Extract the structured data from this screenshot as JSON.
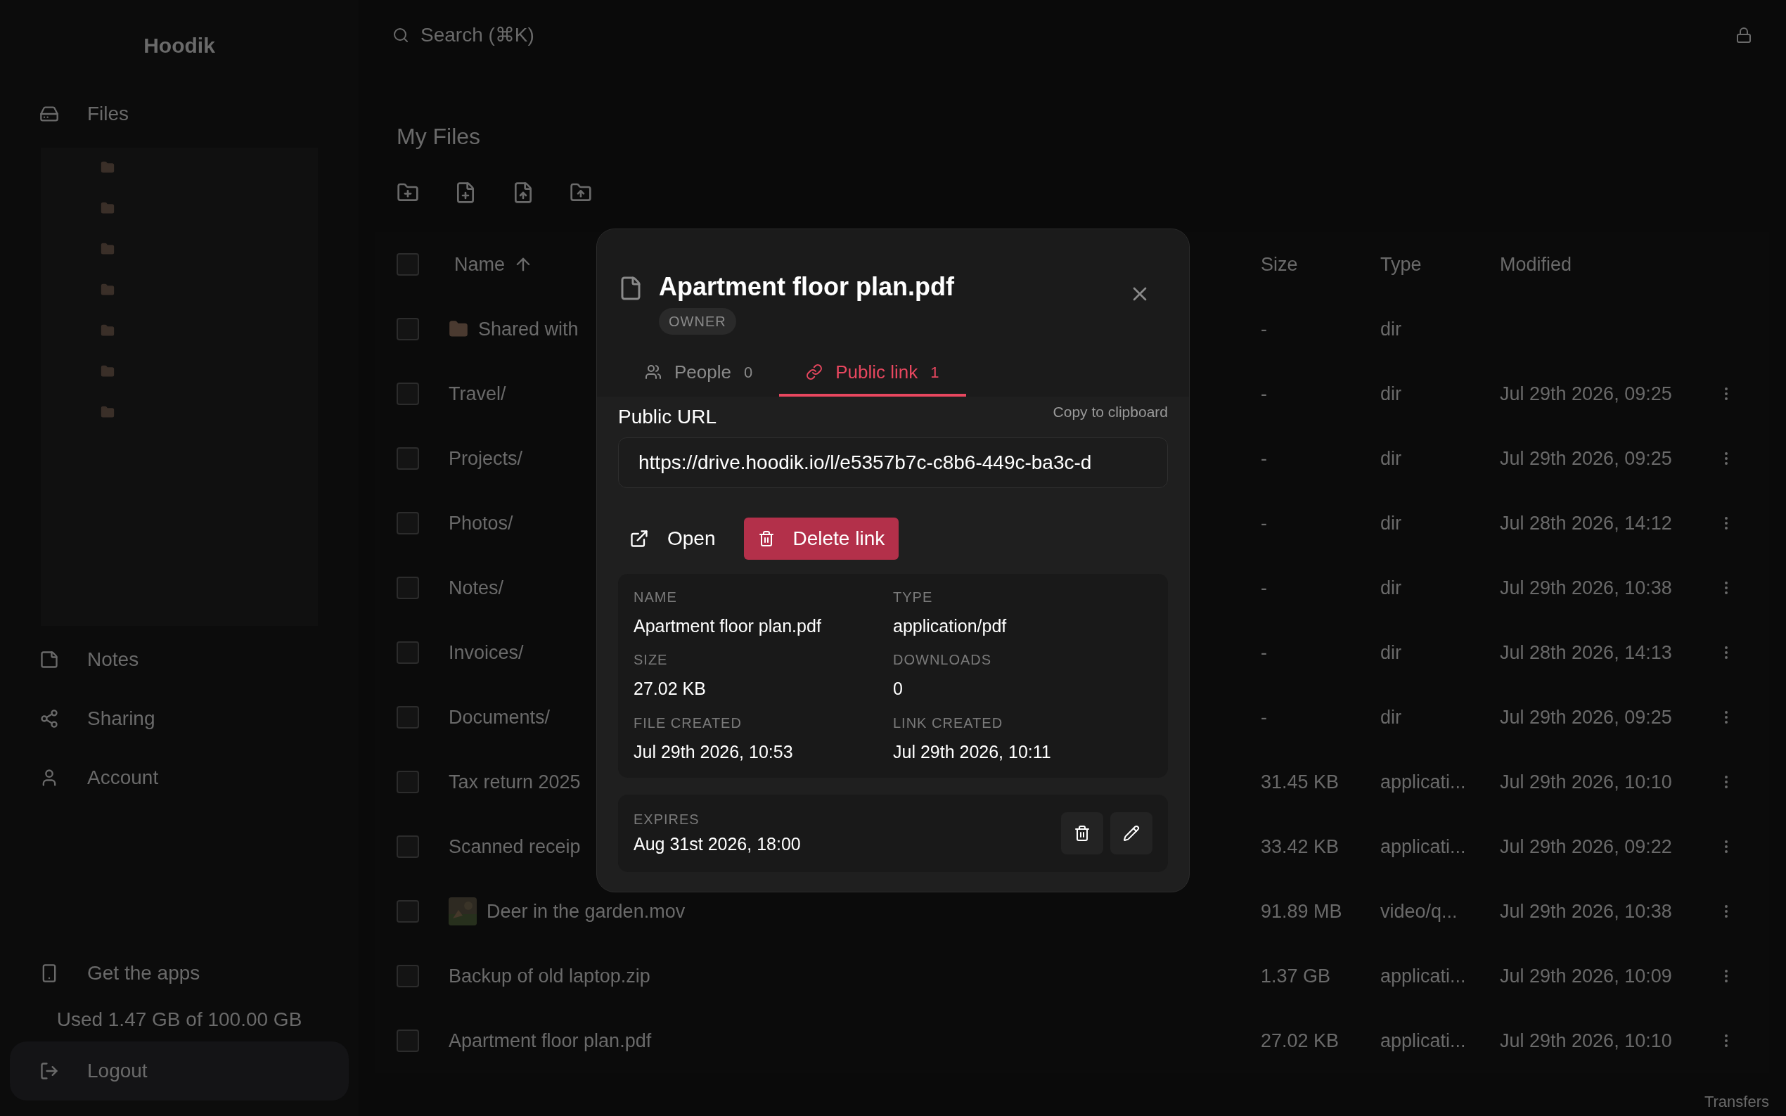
{
  "sidebar": {
    "logo": "Hoodik",
    "nav": [
      {
        "label": "Files",
        "kind": "files"
      },
      {
        "label": "Notes",
        "kind": "notes"
      },
      {
        "label": "Sharing",
        "kind": "sharing"
      },
      {
        "label": "Account",
        "kind": "account"
      }
    ],
    "get_apps": "Get the apps",
    "usage": "Used 1.47 GB of 100.00 GB",
    "logout": "Logout"
  },
  "search": {
    "placeholder": "Search (⌘K)"
  },
  "page_title": "My Files",
  "table": {
    "all_checked": false,
    "columns": [
      "Name",
      "Size",
      "Type",
      "Modified"
    ],
    "rows": [
      {
        "checked": false,
        "name": "Shared with",
        "size": "-",
        "type": "dir",
        "kind": "shared"
      },
      {
        "checked": false,
        "name": "Travel/",
        "size": "-",
        "type": "dir",
        "modified": "Jul 29th 2026, 09:25",
        "kind": "plain"
      },
      {
        "checked": false,
        "name": "Projects/",
        "size": "-",
        "type": "dir",
        "modified": "Jul 29th 2026, 09:25",
        "kind": "plain"
      },
      {
        "checked": false,
        "name": "Photos/",
        "size": "-",
        "type": "dir",
        "modified": "Jul 28th 2026, 14:12",
        "kind": "plain"
      },
      {
        "checked": false,
        "name": "Notes/",
        "size": "-",
        "type": "dir",
        "modified": "Jul 29th 2026, 10:38",
        "kind": "plain"
      },
      {
        "checked": false,
        "name": "Invoices/",
        "size": "-",
        "type": "dir",
        "modified": "Jul 28th 2026, 14:13",
        "kind": "plain"
      },
      {
        "checked": false,
        "name": "Documents/",
        "size": "-",
        "type": "dir",
        "modified": "Jul 29th 2026, 09:25",
        "kind": "plain"
      },
      {
        "checked": false,
        "name": "Tax return 2025",
        "size": "31.45 KB",
        "type": "applicati...",
        "modified": "Jul 29th 2026, 10:10",
        "kind": "plain"
      },
      {
        "checked": false,
        "name": "Scanned receip",
        "size": "33.42 KB",
        "type": "applicati...",
        "modified": "Jul 29th 2026, 09:22",
        "kind": "plain"
      },
      {
        "checked": false,
        "name": "Deer in the garden.mov",
        "size": "91.89 MB",
        "type": "video/q...",
        "modified": "Jul 29th 2026, 10:38",
        "kind": "video"
      },
      {
        "checked": false,
        "name": "Backup of old laptop.zip",
        "size": "1.37 GB",
        "type": "applicati...",
        "modified": "Jul 29th 2026, 10:09",
        "kind": "plain"
      },
      {
        "checked": false,
        "name": "Apartment floor plan.pdf",
        "size": "27.02 KB",
        "type": "applicati...",
        "modified": "Jul 29th 2026, 10:10",
        "kind": "plain"
      }
    ]
  },
  "transfers": "Transfers",
  "dialog": {
    "title": "Apartment floor plan.pdf",
    "badge": "OWNER",
    "tabs": [
      {
        "label": "People",
        "count": "0",
        "selected": false,
        "kind": "people"
      },
      {
        "label": "Public link",
        "count": "1",
        "selected": true,
        "kind": "link"
      }
    ],
    "url_label": "Public URL",
    "copy": "Copy to clipboard",
    "url": "https://drive.hoodik.io/l/e5357b7c-c8b6-449c-ba3c-d",
    "open": "Open",
    "delete": "Delete link",
    "details": [
      {
        "label": "NAME",
        "value": "Apartment floor plan.pdf"
      },
      {
        "label": "TYPE",
        "value": "application/pdf"
      },
      {
        "label": "SIZE",
        "value": "27.02 KB"
      },
      {
        "label": "DOWNLOADS",
        "value": "0"
      },
      {
        "label": "FILE CREATED",
        "value": "Jul 29th 2026, 10:53"
      },
      {
        "label": "LINK CREATED",
        "value": "Jul 29th 2026, 10:11"
      }
    ],
    "expires_label": "EXPIRES",
    "expires": "Aug 31st 2026, 18:00"
  }
}
